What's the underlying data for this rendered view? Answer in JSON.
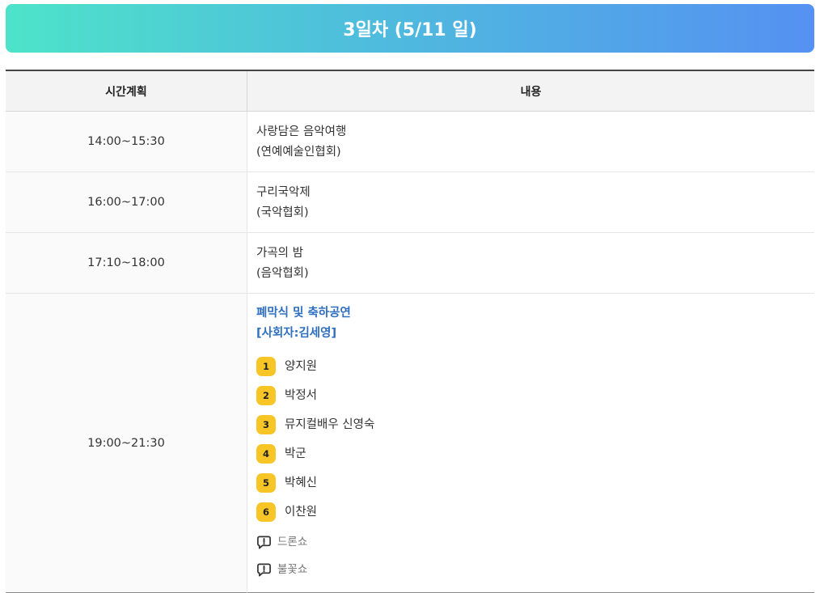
{
  "banner": {
    "title": "3일차 (5/11 일)"
  },
  "table": {
    "headers": {
      "time": "시간계획",
      "content": "내용"
    },
    "rows": [
      {
        "time": "14:00~15:30",
        "line1": "사랑담은 음악여행",
        "line2": "(연예예술인협회)"
      },
      {
        "time": "16:00~17:00",
        "line1": "구리국악제",
        "line2": "(국악협회)"
      },
      {
        "time": "17:10~18:00",
        "line1": "가곡의 밤",
        "line2": "(음악협회)"
      }
    ],
    "closing": {
      "time": "19:00~21:30",
      "title": "폐막식 및 축하공연",
      "host": "[사회자:김세영]",
      "performers": [
        {
          "num": "1",
          "name": "양지원"
        },
        {
          "num": "2",
          "name": "박정서"
        },
        {
          "num": "3",
          "name": "뮤지컬배우 신영숙"
        },
        {
          "num": "4",
          "name": "박군"
        },
        {
          "num": "5",
          "name": "박혜신"
        },
        {
          "num": "6",
          "name": "이찬원"
        }
      ],
      "notes": [
        {
          "icon": "speech-bubble-alert-icon",
          "text": "드론쇼"
        },
        {
          "icon": "speech-bubble-alert-icon",
          "text": "불꽃쇼"
        }
      ]
    }
  }
}
